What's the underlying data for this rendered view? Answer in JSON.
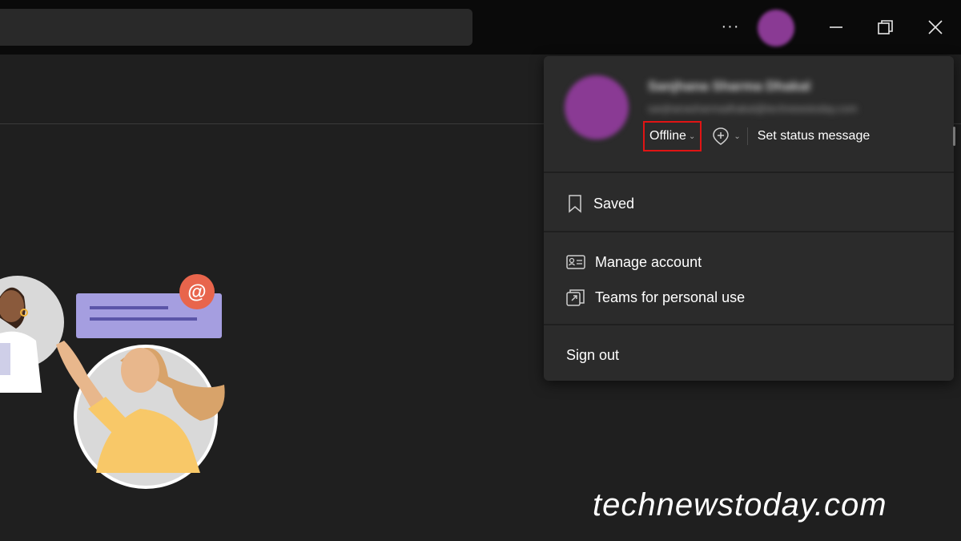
{
  "titlebar": {
    "more_label": "···"
  },
  "profile": {
    "name": "Sanjhana Sharma Dhakal",
    "email": "sanjhanasharmadhakal@technewstoday.com",
    "status_label": "Offline",
    "set_status_label": "Set status message"
  },
  "menu": {
    "saved_label": "Saved",
    "manage_account_label": "Manage account",
    "teams_personal_label": "Teams for personal use",
    "sign_out_label": "Sign out"
  },
  "watermark": "technewstoday.com",
  "colors": {
    "avatar": "#8a3a94",
    "highlight_box": "#e01414",
    "panel_bg": "#2b2b2b",
    "app_bg": "#1f1f1f"
  }
}
